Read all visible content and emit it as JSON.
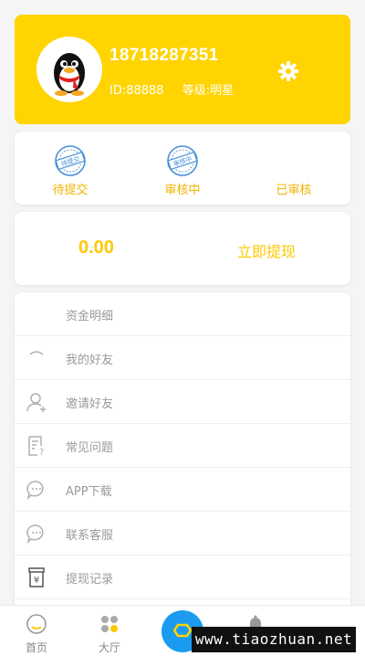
{
  "profile": {
    "phone": "18718287351",
    "id_text": "ID:88888",
    "level_label": "等级:",
    "level_value": "明星",
    "avatar_icon": "qq-penguin-avatar",
    "settings_icon": "gear-icon",
    "bg_color": "#ffd400"
  },
  "status": {
    "items": [
      {
        "label": "待提交",
        "stamp_text": "待提交",
        "icon": "stamp-icon"
      },
      {
        "label": "审核中",
        "stamp_text": "审核中",
        "icon": "stamp-icon"
      },
      {
        "label": "已审核",
        "icon": ""
      }
    ],
    "label_color": "#f0b400"
  },
  "withdraw": {
    "balance": "0.00",
    "button_label": "立即提现",
    "accent_color": "#ffc800"
  },
  "menu": {
    "items": [
      {
        "label": "资金明细",
        "icon": ""
      },
      {
        "label": "我的好友",
        "icon": "friends-icon"
      },
      {
        "label": "邀请好友",
        "icon": "add-user-icon"
      },
      {
        "label": "常见问题",
        "icon": "faq-document-icon"
      },
      {
        "label": "APP下载",
        "icon": "chat-bubble-icon"
      },
      {
        "label": "联系客服",
        "icon": "chat-bubble-icon"
      },
      {
        "label": "提现记录",
        "icon": "yuan-record-icon"
      }
    ]
  },
  "nav": {
    "items": [
      {
        "label": "首页",
        "icon": "home-icon"
      },
      {
        "label": "大厅",
        "icon": "grid-dots-icon"
      },
      {
        "label": "",
        "icon": "center-action-icon"
      },
      {
        "label": "",
        "icon": "bell-icon"
      }
    ],
    "center_color": "#1a9bf0"
  },
  "watermark": "www.tiaozhuan.net"
}
